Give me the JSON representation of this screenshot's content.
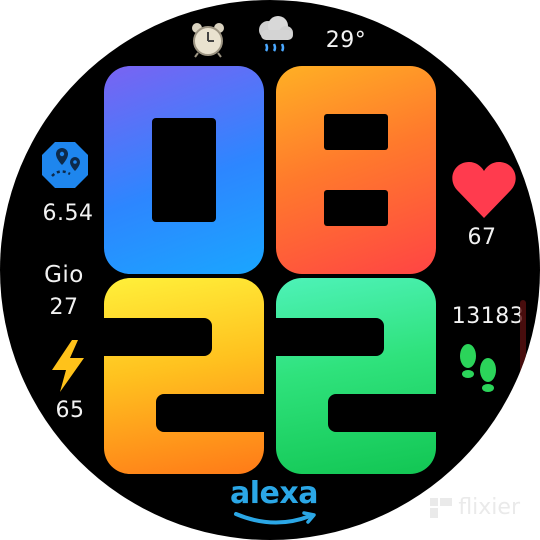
{
  "watch": {
    "status": {
      "temperature": "29°",
      "alarm_icon": "alarm-clock-icon",
      "weather_icon": "rain-cloud-icon"
    },
    "time": {
      "hours": "08",
      "minutes": "22"
    },
    "distance": {
      "value": "6.54",
      "icon": "map-location-icon"
    },
    "date": {
      "day_name": "Gio",
      "day_number": "27"
    },
    "battery": {
      "value": "65",
      "icon": "lightning-bolt-icon"
    },
    "heart_rate": {
      "value": "67",
      "icon": "heart-icon"
    },
    "steps": {
      "value": "13183",
      "icon": "footprints-icon"
    },
    "assistant": {
      "label": "alexa"
    },
    "colors": {
      "digit0": [
        "#7a63f2",
        "#1e8cff"
      ],
      "digit8": [
        "#ff9a22",
        "#ff4141"
      ],
      "digit2a": [
        "#ffe62a",
        "#ff7a1a"
      ],
      "digit2b": [
        "#3fe08a",
        "#10c85c"
      ],
      "heart": "#ff3b4e",
      "accent_blue": "#1e86ee",
      "bolt": "#ffc21a",
      "steps_green": "#2bd45a",
      "alexa": "#2ba7e6"
    }
  },
  "watermark": {
    "text": "flixier"
  }
}
